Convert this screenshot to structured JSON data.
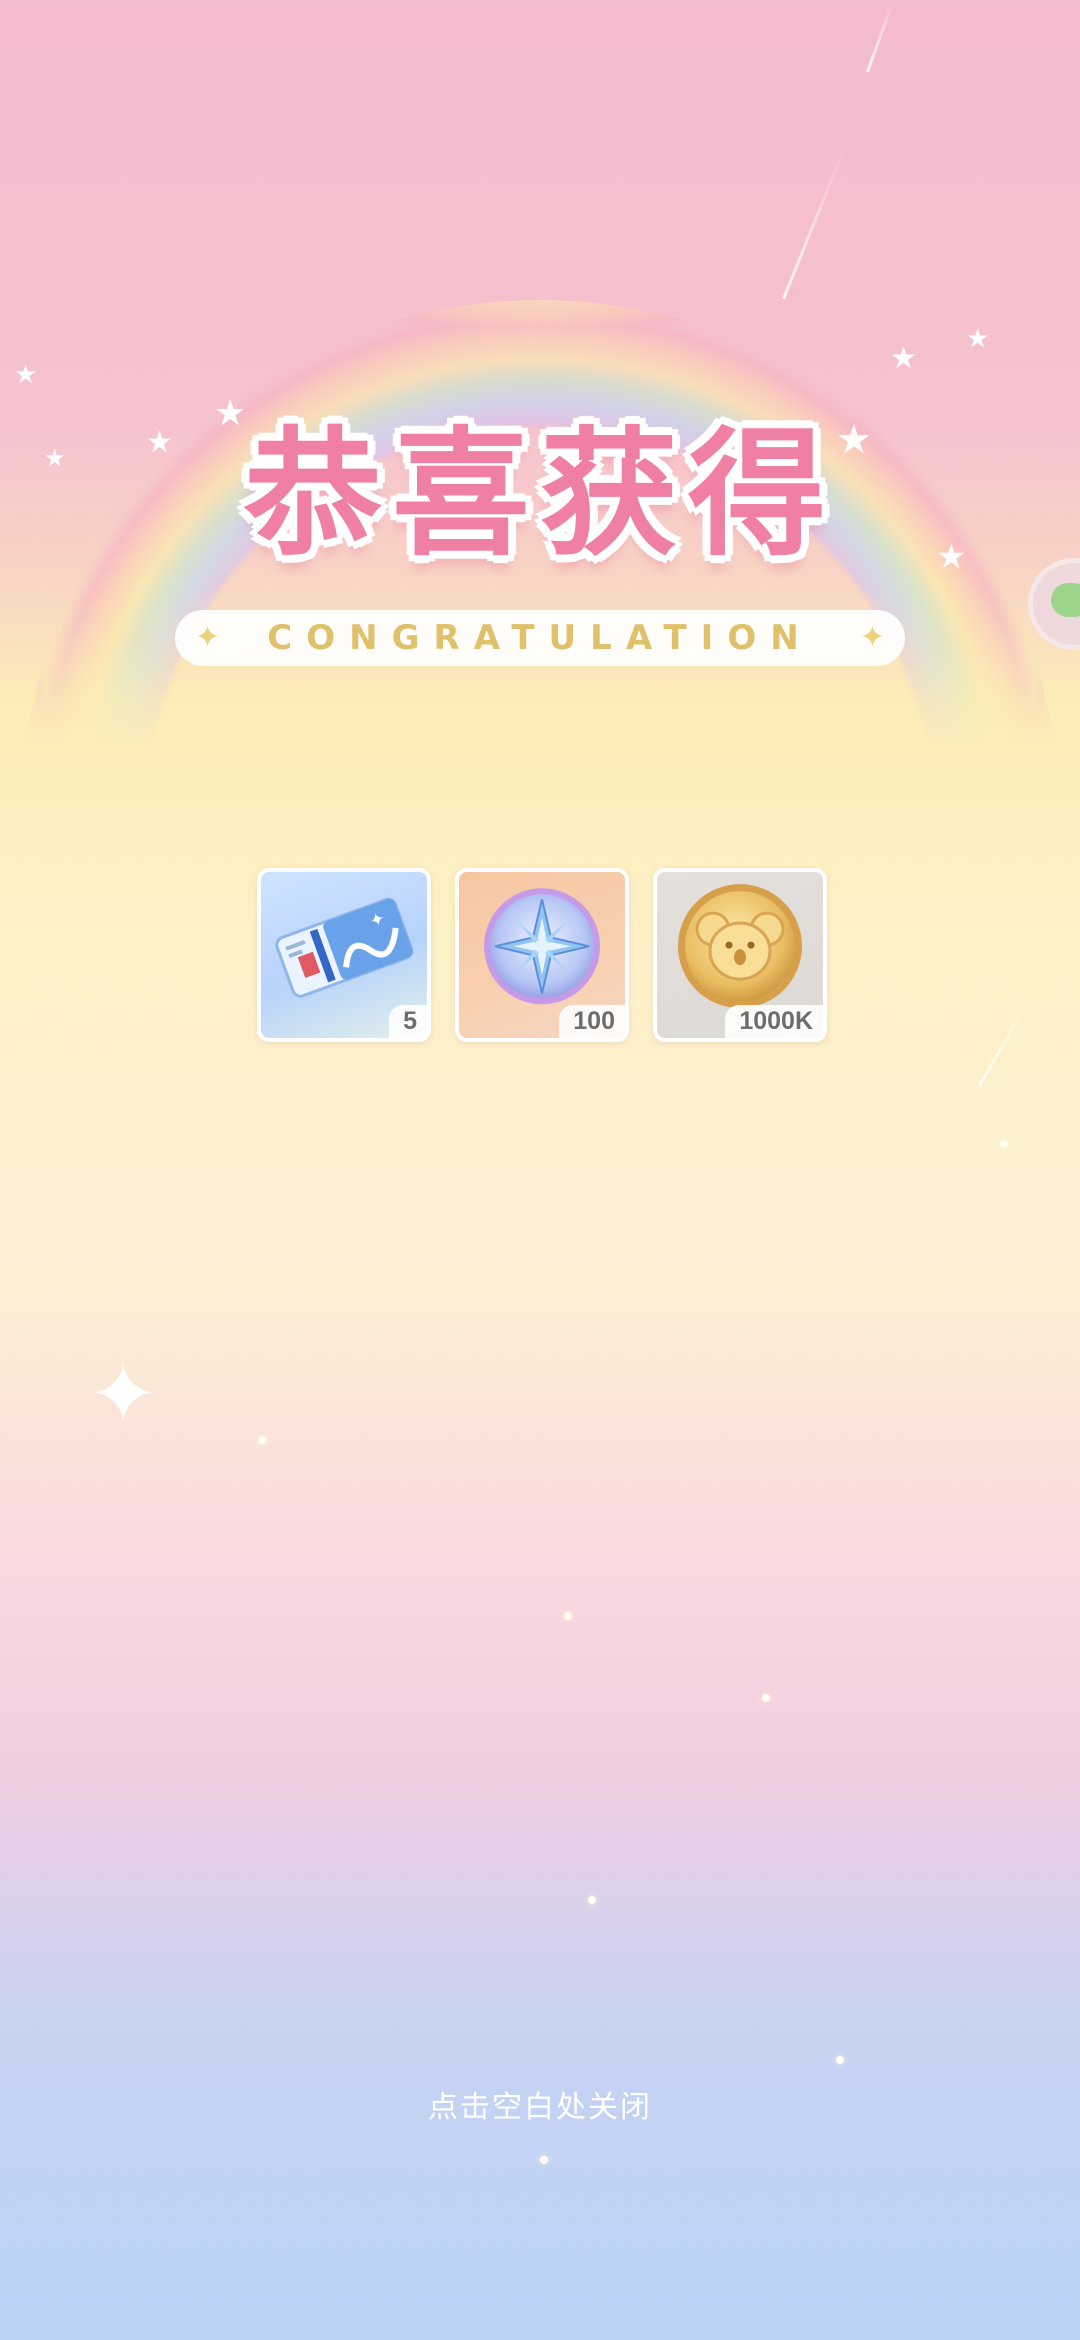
{
  "popup": {
    "title_cn": "恭喜获得",
    "title_en": "CONGRATULATION"
  },
  "rewards": [
    {
      "icon": "ticket-icon",
      "quantity": "5"
    },
    {
      "icon": "star-compass-coin-icon",
      "quantity": "100"
    },
    {
      "icon": "koala-gold-coin-icon",
      "quantity": "1000K"
    }
  ],
  "footer": {
    "close_hint": "点击空白处关闭"
  },
  "colors": {
    "title_pink": "#ef7fa3",
    "subtitle_gold": "#dfc06b"
  }
}
